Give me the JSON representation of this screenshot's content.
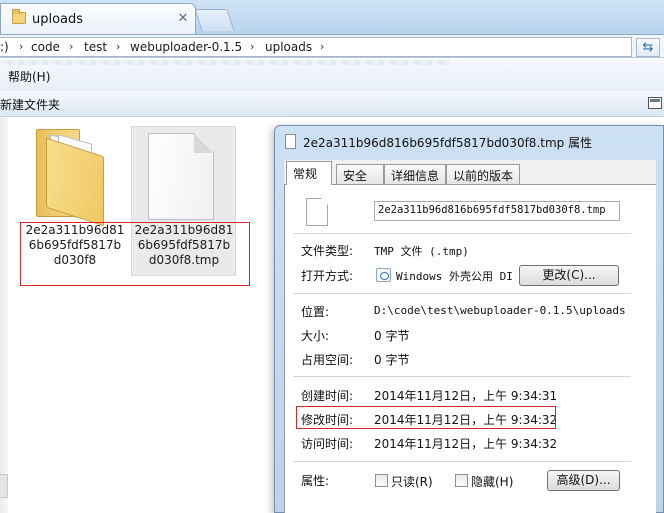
{
  "tab": {
    "title": "uploads",
    "close_glyph": "✕"
  },
  "address": {
    "crumbs": [
      ":)",
      "code",
      "test",
      "webuploader-0.1.5",
      "uploads"
    ],
    "separator": "›",
    "refresh_glyph": "⇆"
  },
  "menu": {
    "help": "帮助(H)"
  },
  "commands": {
    "new_folder": "新建文件夹"
  },
  "files": [
    {
      "name_lines": [
        "2e2a311b96d81",
        "6b695fdf5817b",
        "d030f8"
      ],
      "icon": "folder-icon"
    },
    {
      "name_lines": [
        "2e2a311b96d81",
        "6b695fdf5817b",
        "d030f8.tmp"
      ],
      "icon": "file-icon"
    }
  ],
  "dialog": {
    "title": "2e2a311b96d816b695fdf5817bd030f8.tmp 属性",
    "tabs": [
      "常规",
      "安全",
      "详细信息",
      "以前的版本"
    ],
    "active_tab": "常规",
    "filename": "2e2a311b96d816b695fdf5817bd030f8.tmp",
    "file_type_label": "文件类型:",
    "file_type_value": "TMP 文件 (.tmp)",
    "opens_with_label": "打开方式:",
    "opens_with_value": "Windows 外壳公用 DI",
    "change_button": "更改(C)...",
    "location_label": "位置:",
    "location_value": "D:\\code\\test\\webuploader-0.1.5\\uploads",
    "size_label": "大小:",
    "size_value": "0 字节",
    "size_on_disk_label": "占用空间:",
    "size_on_disk_value": "0 字节",
    "created_label": "创建时间:",
    "created_value": "2014年11月12日，上午 9:34:31",
    "modified_label": "修改时间:",
    "modified_value": "2014年11月12日，上午 9:34:32",
    "accessed_label": "访问时间:",
    "accessed_value": "2014年11月12日，上午 9:34:32",
    "attributes_label": "属性:",
    "readonly_label": "只读(R)",
    "hidden_label": "隐藏(H)",
    "advanced_button": "高级(D)..."
  }
}
